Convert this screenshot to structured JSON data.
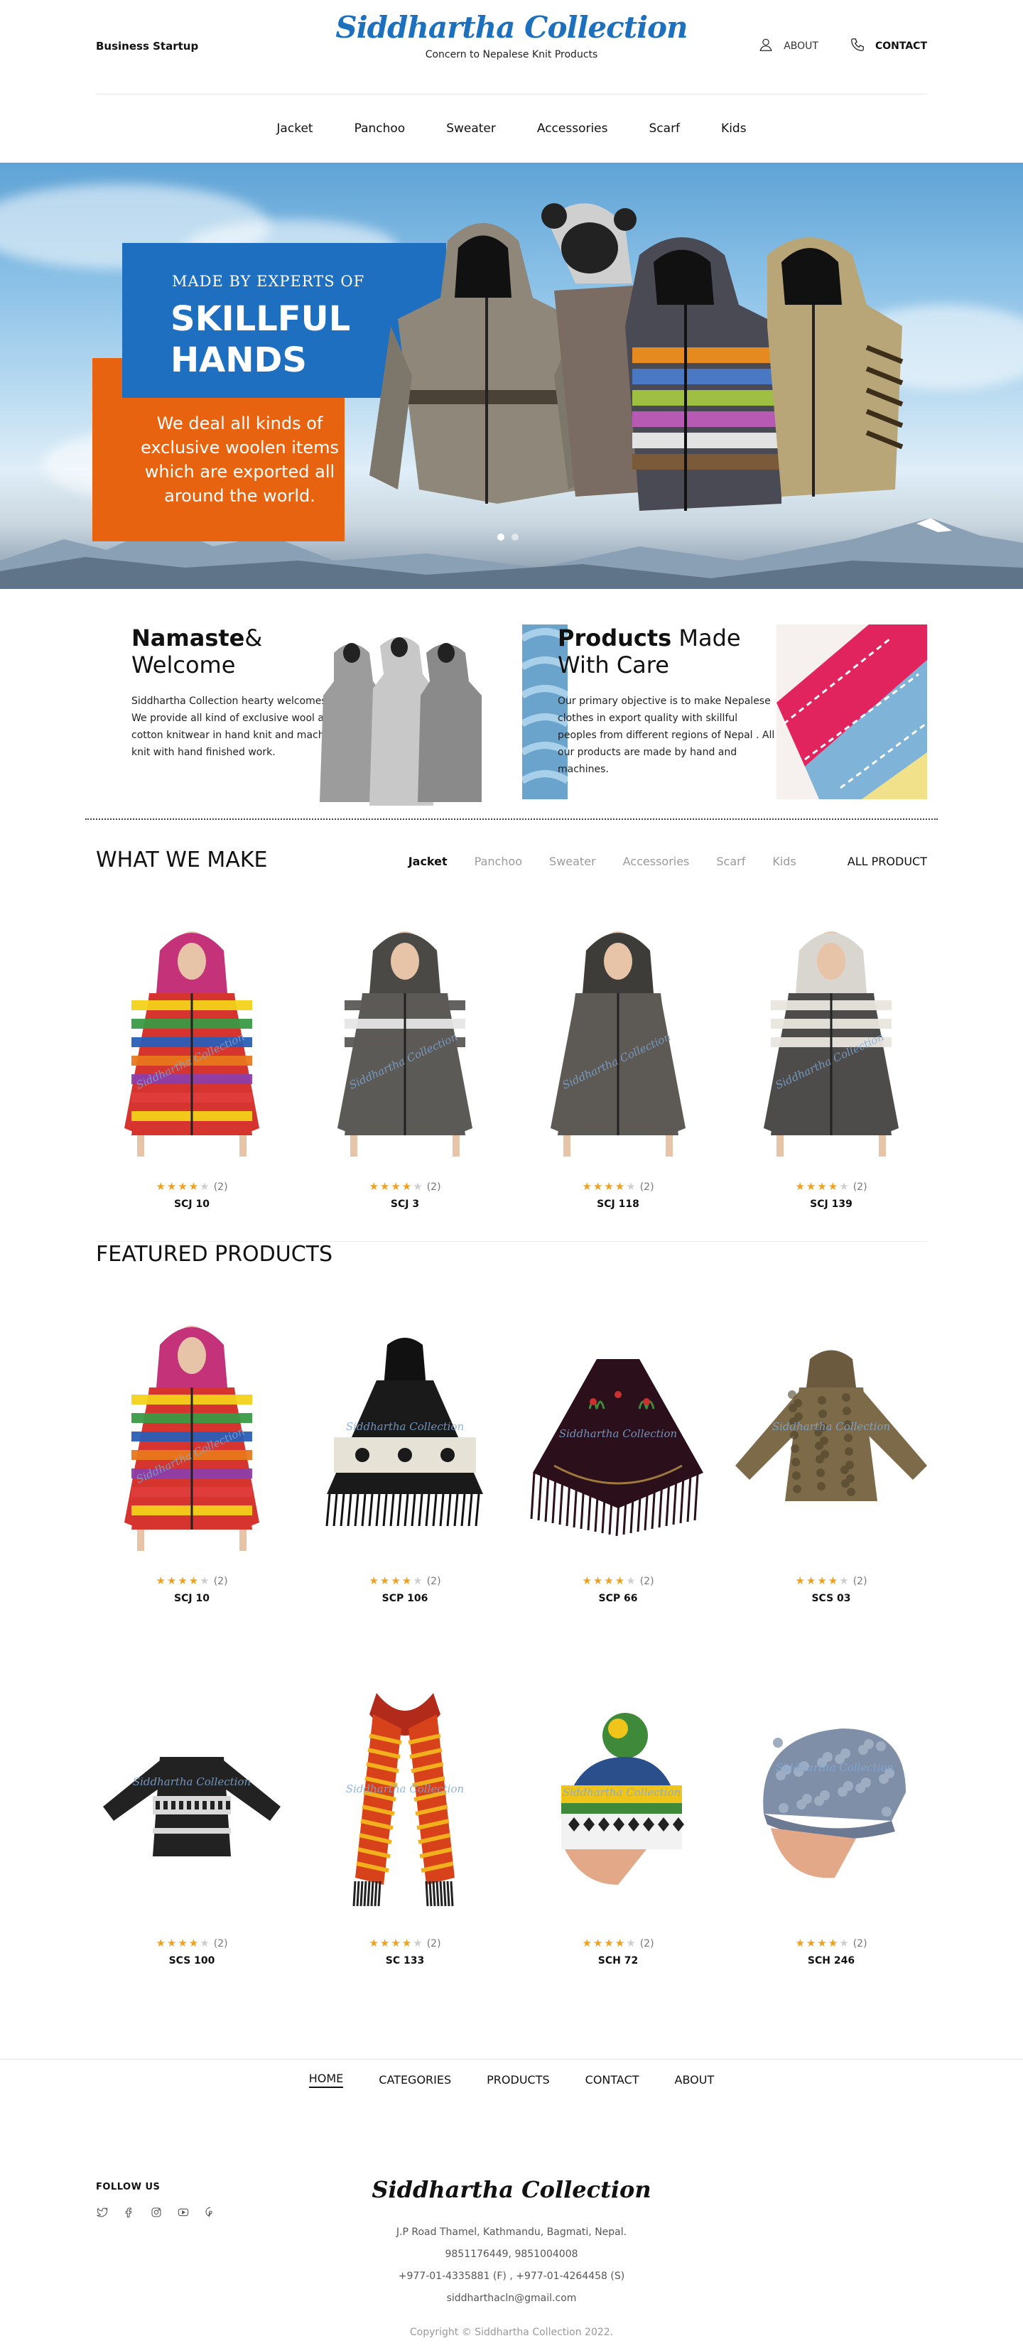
{
  "header": {
    "tagline": "Business Startup",
    "brand": "Siddhartha Collection",
    "brand_sub": "Concern to Nepalese Knit Products",
    "about_label": "ABOUT",
    "contact_label": "CONTACT"
  },
  "nav": [
    "Jacket",
    "Panchoo",
    "Sweater",
    "Accessories",
    "Scarf",
    "Kids"
  ],
  "hero": {
    "small_heading": "MADE BY EXPERTS OF",
    "big_heading": "SKILLFUL HANDS",
    "body": "We deal all kinds of exclusive woolen items which are exported all around the world.",
    "slides": [
      true,
      false
    ]
  },
  "intro": {
    "welcome_bold": "Namaste",
    "welcome_rest": "& Welcome",
    "welcome_text": "Siddhartha Collection hearty welcomes you. We provide all kind of exclusive wool and cotton knitwear in hand knit and machine knit with hand finished work.",
    "products_bold": "Products",
    "products_rest": " Made With Care",
    "products_text": "Our primary objective is to make Nepalese clothes in export quality with skillful peoples from different regions of Nepal . All our products are made by hand and machines."
  },
  "what_we_make": {
    "title": "WHAT WE MAKE",
    "filters": [
      "Jacket",
      "Panchoo",
      "Sweater",
      "Accessories",
      "Scarf",
      "Kids"
    ],
    "active_filter": "Jacket",
    "all_label": "ALL PRODUCT",
    "products": [
      {
        "code": "SCJ 10",
        "rating": 4,
        "reviews": "(2)",
        "image": "rainbow-jacket"
      },
      {
        "code": "SCJ 3",
        "rating": 4,
        "reviews": "(2)",
        "image": "grey-stripe-jacket"
      },
      {
        "code": "SCJ 118",
        "rating": 4,
        "reviews": "(2)",
        "image": "grey-jacket"
      },
      {
        "code": "SCJ 139",
        "rating": 4,
        "reviews": "(2)",
        "image": "white-grey-jacket"
      }
    ]
  },
  "featured": {
    "title": "FEATURED PRODUCTS",
    "products": [
      {
        "code": "SCJ 10",
        "rating": 4,
        "reviews": "(2)",
        "image": "rainbow-jacket"
      },
      {
        "code": "SCP 106",
        "rating": 4,
        "reviews": "(2)",
        "image": "black-poncho"
      },
      {
        "code": "SCP 66",
        "rating": 4,
        "reviews": "(2)",
        "image": "embroidered-poncho"
      },
      {
        "code": "SCS 03",
        "rating": 4,
        "reviews": "(2)",
        "image": "brown-sweater"
      },
      {
        "code": "SCS 100",
        "rating": 4,
        "reviews": "(2)",
        "image": "black-sweater"
      },
      {
        "code": "SC 133",
        "rating": 4,
        "reviews": "(2)",
        "image": "striped-scarf"
      },
      {
        "code": "SCH 72",
        "rating": 4,
        "reviews": "(2)",
        "image": "pompom-hat"
      },
      {
        "code": "SCH 246",
        "rating": 4,
        "reviews": "(2)",
        "image": "slouch-hat"
      }
    ]
  },
  "footer": {
    "nav": [
      "HOME",
      "CATEGORIES",
      "PRODUCTS",
      "CONTACT",
      "ABOUT"
    ],
    "current": "HOME",
    "follow_label": "FOLLOW US",
    "social": [
      "twitter-icon",
      "facebook-icon",
      "instagram-icon",
      "youtube-icon",
      "pinterest-icon"
    ],
    "brand": "Siddhartha Collection",
    "address": "J.P Road Thamel, Kathmandu, Bagmati, Nepal.",
    "phone": "9851176449, 9851004008",
    "landline": "+977-01-4335881 (F) , +977-01-4264458 (S)",
    "email": "siddharthacln@gmail.com",
    "copyright": "Copyright © Siddhartha Collection 2022."
  },
  "watermark": "Siddhartha Collection",
  "colors": {
    "brand_blue": "#1d70bd",
    "hero_orange": "#e8630f",
    "hero_blue": "#1e6fc0",
    "star": "#f0a020"
  }
}
